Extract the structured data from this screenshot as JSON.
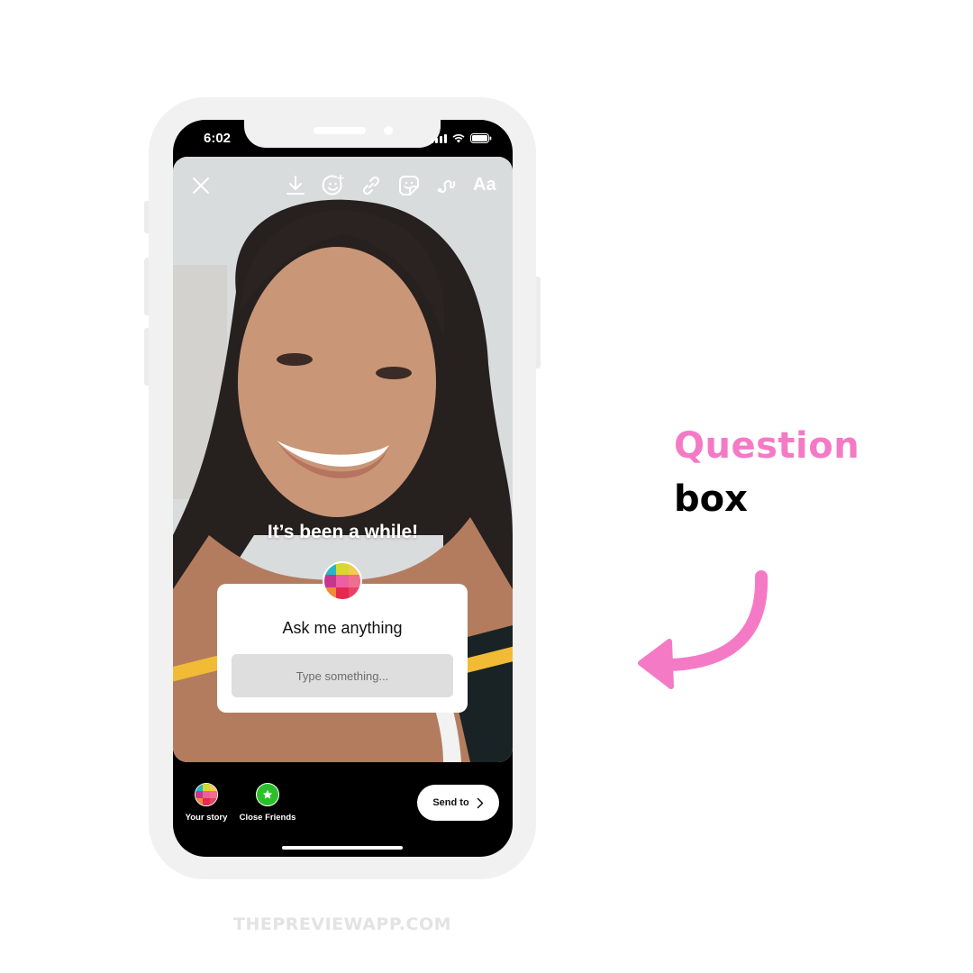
{
  "status_bar": {
    "time": "6:02",
    "icons": [
      "signal-icon",
      "wifi-icon",
      "battery-icon"
    ]
  },
  "story_toolbar": {
    "close_icon": "close-icon",
    "tools": [
      "download-icon",
      "face-effects-icon",
      "link-icon",
      "sticker-icon",
      "draw-icon",
      "text-tool"
    ],
    "text_tool_label": "Aa"
  },
  "story": {
    "caption": "It’s been a while!",
    "question_sticker": {
      "title": "Ask me anything",
      "input_placeholder": "Type something..."
    },
    "avatar_colors": [
      "#27b6c4",
      "#d8d92a",
      "#f3cb4d",
      "#c8358f",
      "#ec5fa4",
      "#ef6f8c",
      "#f08a3d",
      "#e5294f",
      "#e8426b"
    ]
  },
  "share_bar": {
    "your_story_label": "Your story",
    "close_friends_label": "Close Friends",
    "send_to_label": "Send to"
  },
  "annotation": {
    "highlight_word": "Question",
    "rest_word": "box",
    "highlight_color": "#f47ac6"
  },
  "footer": {
    "brand": "THEPREVIEWAPP.COM"
  }
}
